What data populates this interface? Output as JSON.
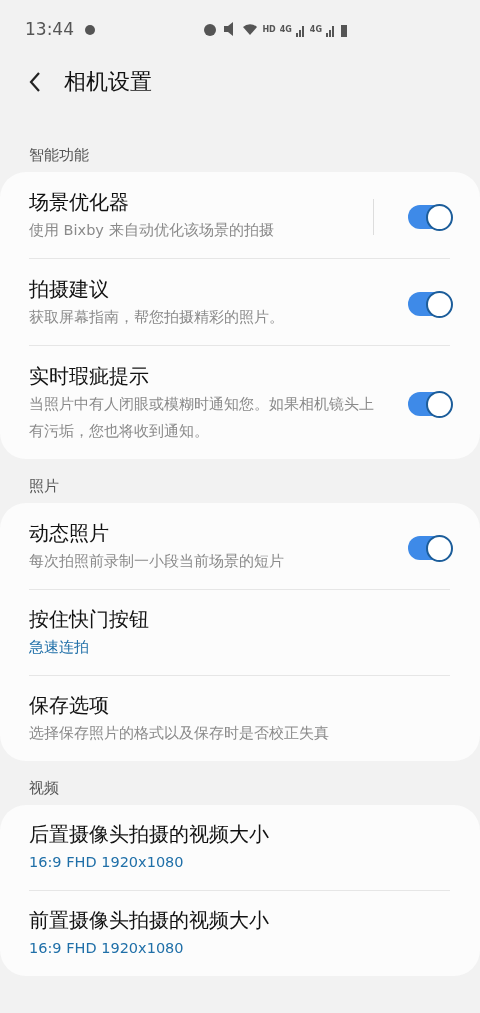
{
  "status_bar": {
    "time": "13:44",
    "hd": "HD",
    "network_1": "4G",
    "network_2": "4G"
  },
  "header": {
    "title": "相机设置"
  },
  "sections": [
    {
      "title": "智能功能",
      "items": [
        {
          "kind": "toggle",
          "title": "场景优化器",
          "summary": "使用 Bixby 来自动优化该场景的拍摄",
          "on": true,
          "divider": true
        },
        {
          "kind": "toggle",
          "title": "拍摄建议",
          "summary": "获取屏幕指南，帮您拍摄精彩的照片。",
          "on": true,
          "divider": false
        },
        {
          "kind": "toggle",
          "title": "实时瑕疵提示",
          "summary": "当照片中有人闭眼或模糊时通知您。如果相机镜头上有污垢，您也将收到通知。",
          "on": true,
          "divider": false
        }
      ]
    },
    {
      "title": "照片",
      "items": [
        {
          "kind": "toggle",
          "title": "动态照片",
          "summary": "每次拍照前录制一小段当前场景的短片",
          "on": true,
          "divider": false
        },
        {
          "kind": "value",
          "title": "按住快门按钮",
          "summary": "急速连拍"
        },
        {
          "kind": "nav",
          "title": "保存选项",
          "summary": "选择保存照片的格式以及保存时是否校正失真"
        }
      ]
    },
    {
      "title": "视频",
      "items": [
        {
          "kind": "value",
          "title": "后置摄像头拍摄的视频大小",
          "summary": "16:9 FHD 1920x1080"
        },
        {
          "kind": "value",
          "title": "前置摄像头拍摄的视频大小",
          "summary": "16:9 FHD 1920x1080"
        }
      ]
    }
  ]
}
